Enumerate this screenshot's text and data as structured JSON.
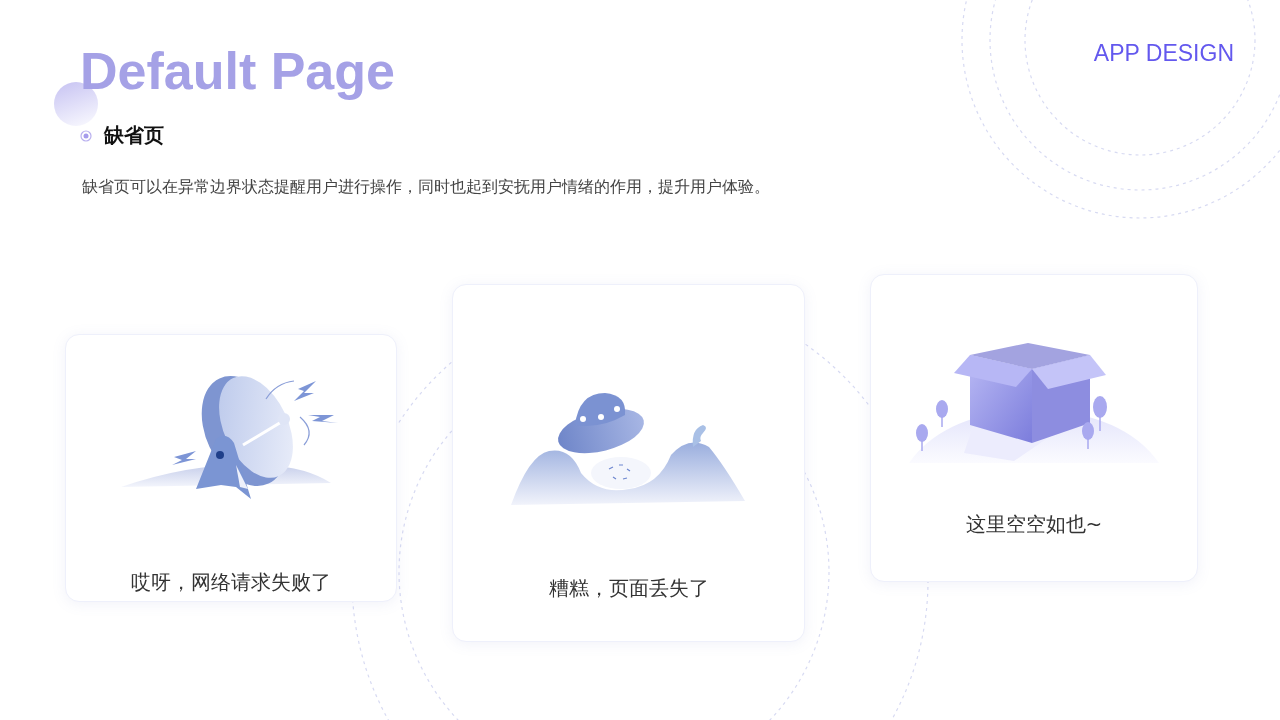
{
  "header": {
    "title": "Default Page",
    "tag": "APP DESIGN"
  },
  "section": {
    "heading": "缺省页",
    "description": "缺省页可以在异常边界状态提醒用户进行操作，同时也起到安抚用户情绪的作用，提升用户体验。"
  },
  "cards": [
    {
      "kind": "network",
      "message": "哎呀，网络请求失败了"
    },
    {
      "kind": "missing",
      "message": "糟糕，页面丢失了"
    },
    {
      "kind": "empty",
      "message": "这里空空如也~"
    }
  ]
}
